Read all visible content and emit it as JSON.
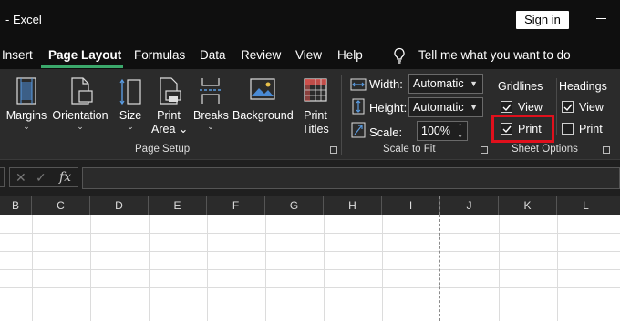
{
  "window": {
    "title": "-  Excel",
    "sign_in": "Sign in"
  },
  "tabs": [
    "Insert",
    "Page Layout",
    "Formulas",
    "Data",
    "Review",
    "View",
    "Help"
  ],
  "active_tab": "Page Layout",
  "tell_me": "Tell me what you want to do",
  "ribbon": {
    "page_setup": {
      "label": "Page Setup",
      "buttons": {
        "margins": "Margins",
        "orientation": "Orientation",
        "size": "Size",
        "print_area_1": "Print",
        "print_area_2": "Area",
        "breaks": "Breaks",
        "background": "Background",
        "print_titles_1": "Print",
        "print_titles_2": "Titles"
      }
    },
    "scale_to_fit": {
      "label": "Scale to Fit",
      "width_label": "Width:",
      "width_value": "Automatic",
      "height_label": "Height:",
      "height_value": "Automatic",
      "scale_label": "Scale:",
      "scale_value": "100%"
    },
    "sheet_options": {
      "label": "Sheet Options",
      "gridlines": {
        "heading": "Gridlines",
        "view": "View",
        "view_checked": true,
        "print": "Print",
        "print_checked": true
      },
      "headings": {
        "heading": "Headings",
        "view": "View",
        "view_checked": true,
        "print": "Print",
        "print_checked": false
      }
    }
  },
  "formula_bar": {
    "cancel": "✕",
    "enter": "✓",
    "fx": "fx"
  },
  "columns": [
    "B",
    "C",
    "D",
    "E",
    "F",
    "G",
    "H",
    "I",
    "J",
    "K",
    "L"
  ],
  "colors": {
    "highlight": "#e0101c",
    "active_tab_underline": "#3ba86b"
  }
}
